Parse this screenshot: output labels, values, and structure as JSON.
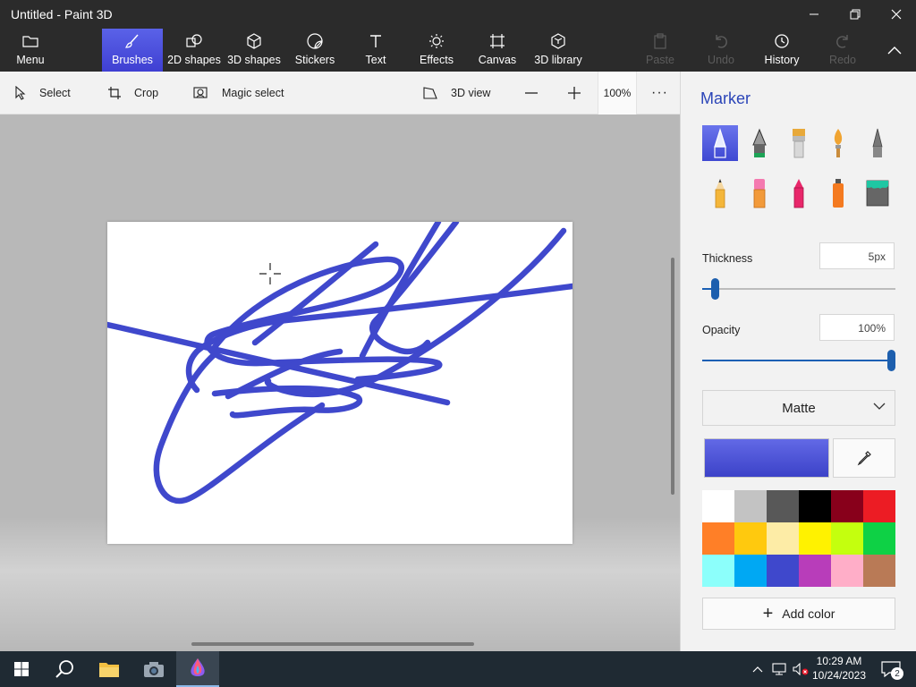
{
  "window": {
    "title": "Untitled - Paint 3D"
  },
  "ribbon": {
    "menu": "Menu",
    "tools": [
      {
        "label": "Brushes"
      },
      {
        "label": "2D shapes"
      },
      {
        "label": "3D shapes"
      },
      {
        "label": "Stickers"
      },
      {
        "label": "Text"
      },
      {
        "label": "Effects"
      },
      {
        "label": "Canvas"
      },
      {
        "label": "3D library"
      }
    ],
    "actions": [
      {
        "label": "Paste",
        "enabled": false
      },
      {
        "label": "Undo",
        "enabled": false
      },
      {
        "label": "History",
        "enabled": true
      },
      {
        "label": "Redo",
        "enabled": false
      }
    ]
  },
  "toolbar": {
    "select": "Select",
    "crop": "Crop",
    "magic_select": "Magic select",
    "view3d": "3D view",
    "zoom": "100%",
    "more": "···"
  },
  "panel": {
    "title": "Marker",
    "brushes": [
      "marker-icon",
      "calligraphy-pen-icon",
      "oil-brush-icon",
      "watercolor-icon",
      "pixel-pen-icon",
      "pencil-icon",
      "eraser-icon",
      "crayon-icon",
      "spray-can-icon",
      "fill-bucket-icon"
    ],
    "thickness_label": "Thickness",
    "thickness_value": "5px",
    "thickness_fraction": 0.05,
    "opacity_label": "Opacity",
    "opacity_value": "100%",
    "opacity_fraction": 1.0,
    "finish": "Matte",
    "current_color": "#4a51d8",
    "palette": [
      "#ffffff",
      "#c3c3c3",
      "#585858",
      "#000000",
      "#88001b",
      "#ec1c24",
      "#ff7f27",
      "#ffc90e",
      "#fdeca6",
      "#fff200",
      "#c4ff0e",
      "#0ed145",
      "#8cfffb",
      "#00a8f3",
      "#3f48cc",
      "#b83dba",
      "#ffaec8",
      "#b97a56"
    ],
    "add_color": "Add color"
  },
  "taskbar": {
    "time": "10:29 AM",
    "date": "10/24/2023",
    "notifications": "2"
  },
  "colors": {
    "accent": "#3f48cc",
    "stroke": "#3f48cc"
  }
}
